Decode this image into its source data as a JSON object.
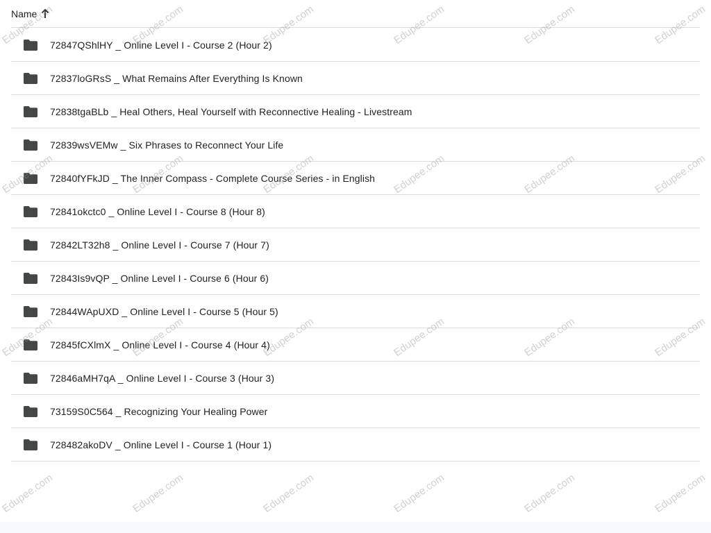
{
  "header": {
    "name_label": "Name",
    "sort_icon": "arrow-up-icon"
  },
  "folders": [
    {
      "label": "72847QShlHY _ Online Level I - Course 2 (Hour 2)",
      "icon": "folder-icon"
    },
    {
      "label": "72837loGRsS _ What Remains After Everything Is Known",
      "icon": "folder-icon"
    },
    {
      "label": "72838tgaBLb _ Heal Others, Heal Yourself with Reconnective Healing - Livestream",
      "icon": "folder-icon"
    },
    {
      "label": "72839wsVEMw _ Six Phrases to Reconnect Your Life",
      "icon": "folder-icon"
    },
    {
      "label": "72840fYFkJD _ The Inner Compass - Complete Course Series - in English",
      "icon": "folder-icon"
    },
    {
      "label": "72841okctc0 _ Online Level I - Course 8 (Hour 8)",
      "icon": "folder-icon"
    },
    {
      "label": "72842LT32h8 _ Online Level I - Course 7 (Hour 7)",
      "icon": "folder-icon"
    },
    {
      "label": "72843Is9vQP _ Online Level I - Course 6 (Hour 6)",
      "icon": "folder-icon"
    },
    {
      "label": "72844WApUXD _ Online Level I - Course 5 (Hour 5)",
      "icon": "folder-icon"
    },
    {
      "label": "72845fCXlmX _ Online Level I - Course 4 (Hour 4)",
      "icon": "folder-icon"
    },
    {
      "label": "72846aMH7qA _ Online Level I - Course 3 (Hour 3)",
      "icon": "folder-icon"
    },
    {
      "label": "73159S0C564 _ Recognizing Your Healing Power",
      "icon": "folder-icon"
    },
    {
      "label": "728482akoDV _ Online Level I - Course 1 (Hour 1)",
      "icon": "folder-icon"
    }
  ],
  "watermark": {
    "text": "Edupee.com"
  },
  "colors": {
    "divider": "#dadce0",
    "text": "#1f1f1f",
    "icon": "#444746"
  }
}
